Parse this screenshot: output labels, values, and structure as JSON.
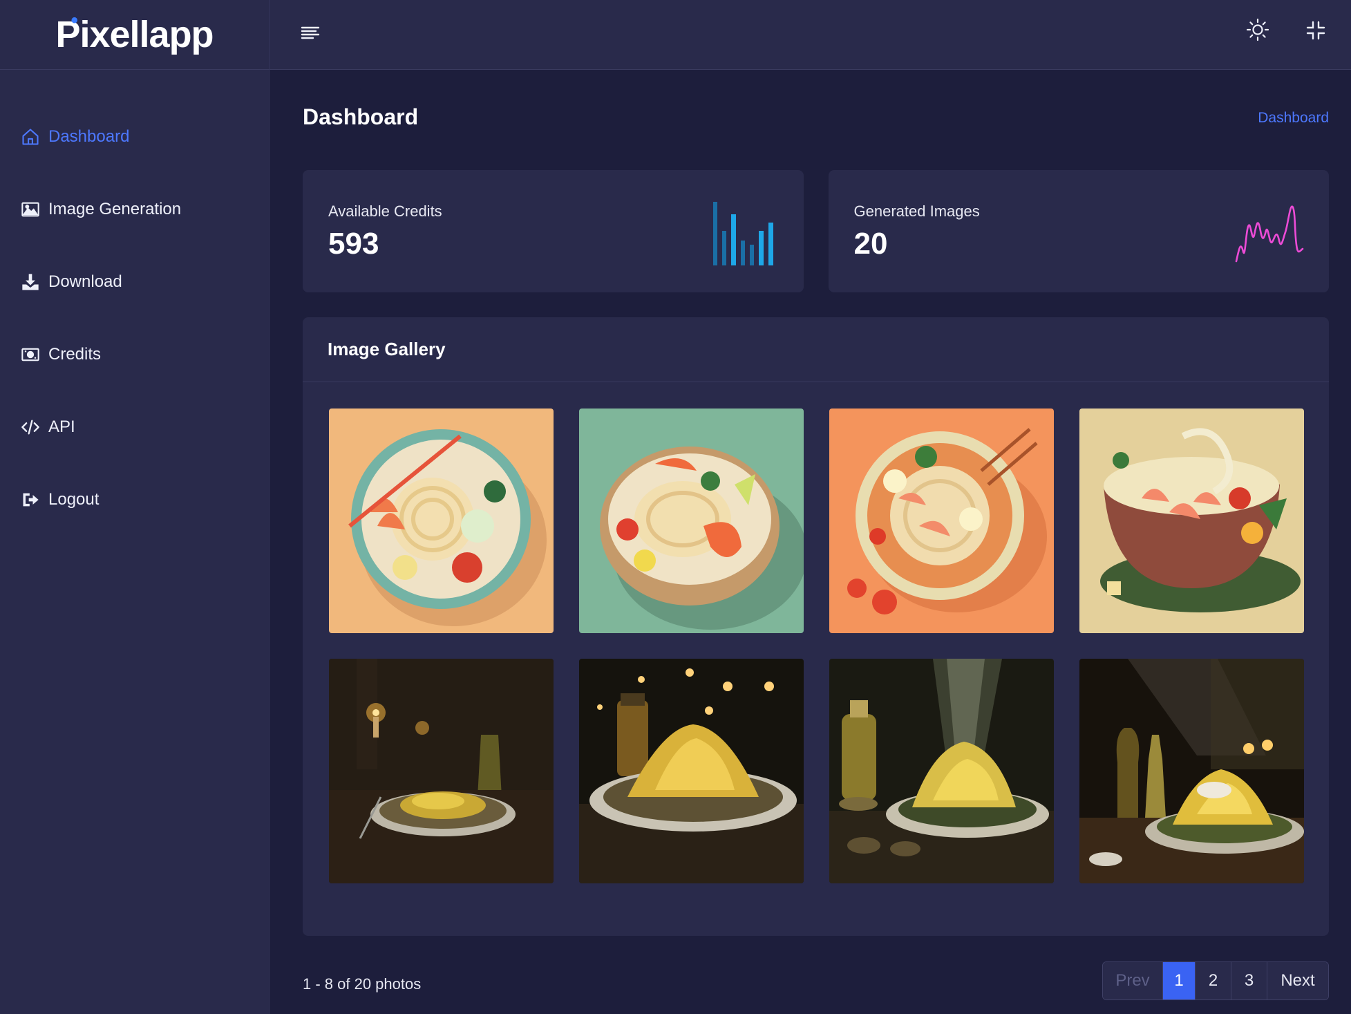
{
  "brand": {
    "name_p": "P",
    "name_rest": "ixellapp"
  },
  "sidebar": {
    "items": [
      {
        "label": "Dashboard",
        "icon": "home-icon",
        "active": true
      },
      {
        "label": "Image Generation",
        "icon": "image-icon"
      },
      {
        "label": "Download",
        "icon": "download-icon"
      },
      {
        "label": "Credits",
        "icon": "money-icon"
      },
      {
        "label": "API",
        "icon": "code-icon"
      },
      {
        "label": "Logout",
        "icon": "logout-icon"
      }
    ]
  },
  "header": {
    "menu_icon": "hamburger-menu-icon",
    "theme_icon": "sun-icon",
    "fullscreen_icon": "collapse-fullscreen-icon"
  },
  "page": {
    "title": "Dashboard",
    "breadcrumb": "Dashboard"
  },
  "stats": {
    "credits": {
      "label": "Available Credits",
      "value": "593",
      "chart_color": "#1ea7e8"
    },
    "images": {
      "label": "Generated Images",
      "value": "20",
      "chart_color": "#ec4bd6"
    }
  },
  "gallery": {
    "title": "Image Gallery",
    "images": [
      {
        "subject": "noodle-bowl-shrimp",
        "bg": "#f1b87c"
      },
      {
        "subject": "noodle-bowl-shrimp",
        "bg": "#7fb69a"
      },
      {
        "subject": "noodle-bowl-shrimp",
        "bg": "#f4945c"
      },
      {
        "subject": "noodle-bowl-shrimp",
        "bg": "#e4d09b"
      },
      {
        "subject": "pasta-plate-candlelight",
        "bg": "#1b160f"
      },
      {
        "subject": "pasta-plate-candlelight",
        "bg": "#15130d"
      },
      {
        "subject": "pasta-plate-candlelight",
        "bg": "#1a1a12"
      },
      {
        "subject": "pasta-plate-candlelight",
        "bg": "#17120c"
      }
    ]
  },
  "pagination": {
    "summary": "1 - 8 of 20 photos",
    "prev": "Prev",
    "pages": [
      "1",
      "2",
      "3"
    ],
    "current": "1",
    "next": "Next"
  },
  "colors": {
    "accent": "#4d78ff",
    "panel": "#292a4b",
    "background": "#1d1e3c"
  }
}
